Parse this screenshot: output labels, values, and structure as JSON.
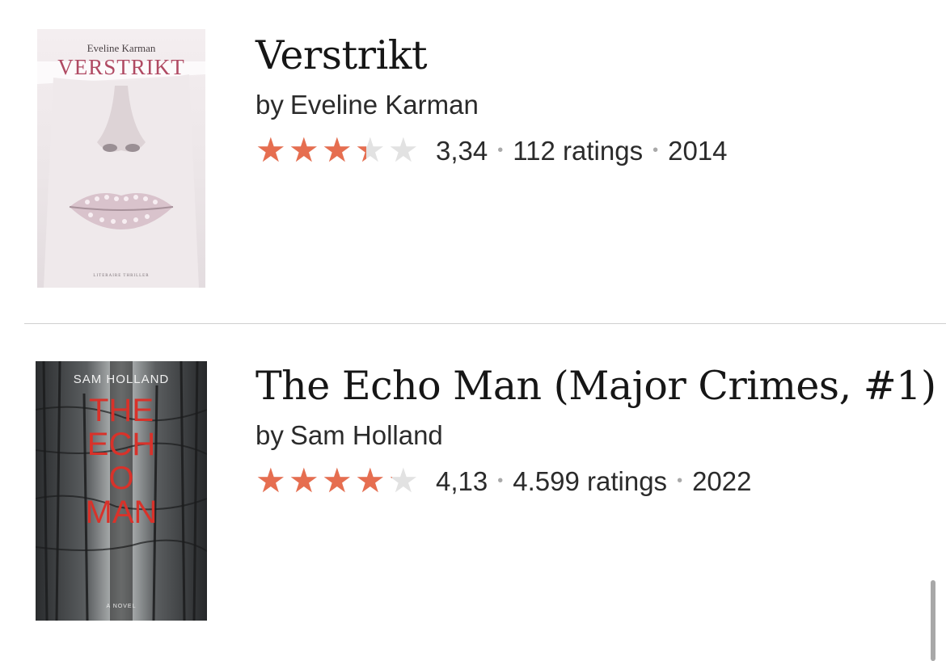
{
  "books": [
    {
      "title": "Verstrikt",
      "author_prefix": "by",
      "author": "Eveline Karman",
      "average_rating": "3,34",
      "rating_value": 3.34,
      "ratings_count": "112 ratings",
      "year": "2014",
      "cover": {
        "author_text": "Eveline Karman",
        "title_text": "VERSTRIKT",
        "tagline": "LITERAIRE THRILLER"
      }
    },
    {
      "title": "The Echo Man (Major Crimes, #1)",
      "author_prefix": "by",
      "author": "Sam Holland",
      "average_rating": "4,13",
      "rating_value": 4.13,
      "ratings_count": "4.599 ratings",
      "year": "2022",
      "cover": {
        "author_text": "SAM HOLLAND",
        "title_text": "THE ECHO MAN",
        "tagline": "A NOVEL"
      }
    }
  ],
  "separator": "•",
  "colors": {
    "star_filled": "#e66e50",
    "star_empty": "#e2e2e2",
    "divider": "#cfcfcf"
  }
}
